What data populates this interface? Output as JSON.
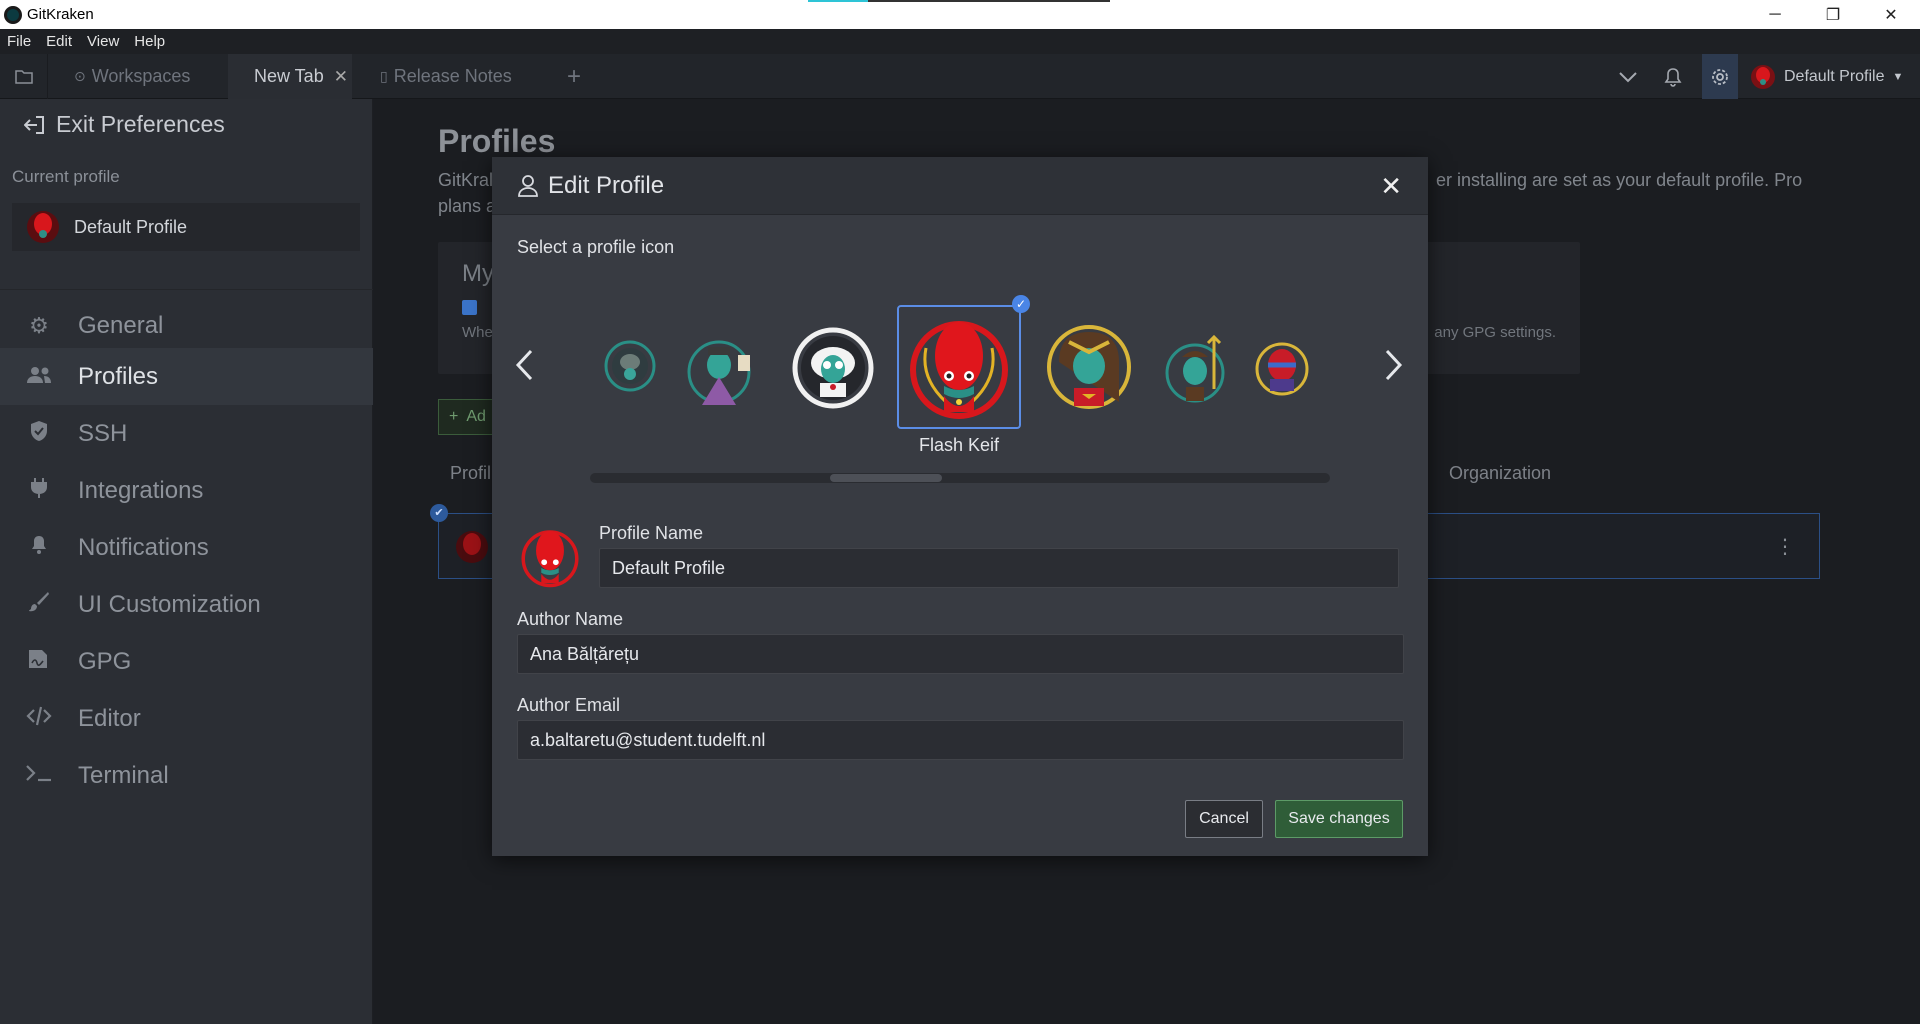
{
  "window": {
    "app_title": "GitKraken",
    "controls": {
      "minimize": "─",
      "restore": "❐",
      "close": "✕"
    }
  },
  "menubar": [
    "File",
    "Edit",
    "View",
    "Help"
  ],
  "tabs": {
    "workspaces": "Workspaces",
    "new_tab": "New Tab",
    "release_notes": "Release Notes",
    "add": "+"
  },
  "toolbar_right": {
    "profile_label": "Default Profile"
  },
  "sidebar": {
    "exit_label": "Exit Preferences",
    "current_profile_heading": "Current profile",
    "current_profile_name": "Default Profile",
    "items": [
      {
        "label": "General",
        "icon": "gear-icon"
      },
      {
        "label": "Profiles",
        "icon": "users-icon"
      },
      {
        "label": "SSH",
        "icon": "shield-icon"
      },
      {
        "label": "Integrations",
        "icon": "plug-icon"
      },
      {
        "label": "Notifications",
        "icon": "bell-icon"
      },
      {
        "label": "UI Customization",
        "icon": "brush-icon"
      },
      {
        "label": "GPG",
        "icon": "signature-icon"
      },
      {
        "label": "Editor",
        "icon": "code-icon"
      },
      {
        "label": "Terminal",
        "icon": "terminal-icon"
      }
    ],
    "active_index": 1
  },
  "main": {
    "title": "Profiles",
    "desc_start": "GitKral",
    "desc_end": "er installing are set as your default profile. Pro",
    "desc_line2": "plans a",
    "card_title": "My",
    "card_sub_left": "Whe",
    "card_sub_right": "any GPG settings.",
    "add_label": "Ad",
    "col_profile": "Profil",
    "col_org": "Organization"
  },
  "modal": {
    "title": "Edit Profile",
    "close": "✕",
    "select_icon_label": "Select a profile icon",
    "prev_arrow": "‹",
    "next_arrow": "›",
    "selected_icon_name": "Flash Keif",
    "profile_name_label": "Profile Name",
    "profile_name_value": "Default Profile",
    "author_name_label": "Author Name",
    "author_name_value": "Ana Bălțărețu",
    "author_email_label": "Author Email",
    "author_email_value": "a.baltaretu@student.tudelft.nl",
    "cancel_label": "Cancel",
    "save_label": "Save changes"
  },
  "colors": {
    "accent_blue": "#4a85e6",
    "save_green": "#2f5d38",
    "keif_red": "#d8171c"
  }
}
